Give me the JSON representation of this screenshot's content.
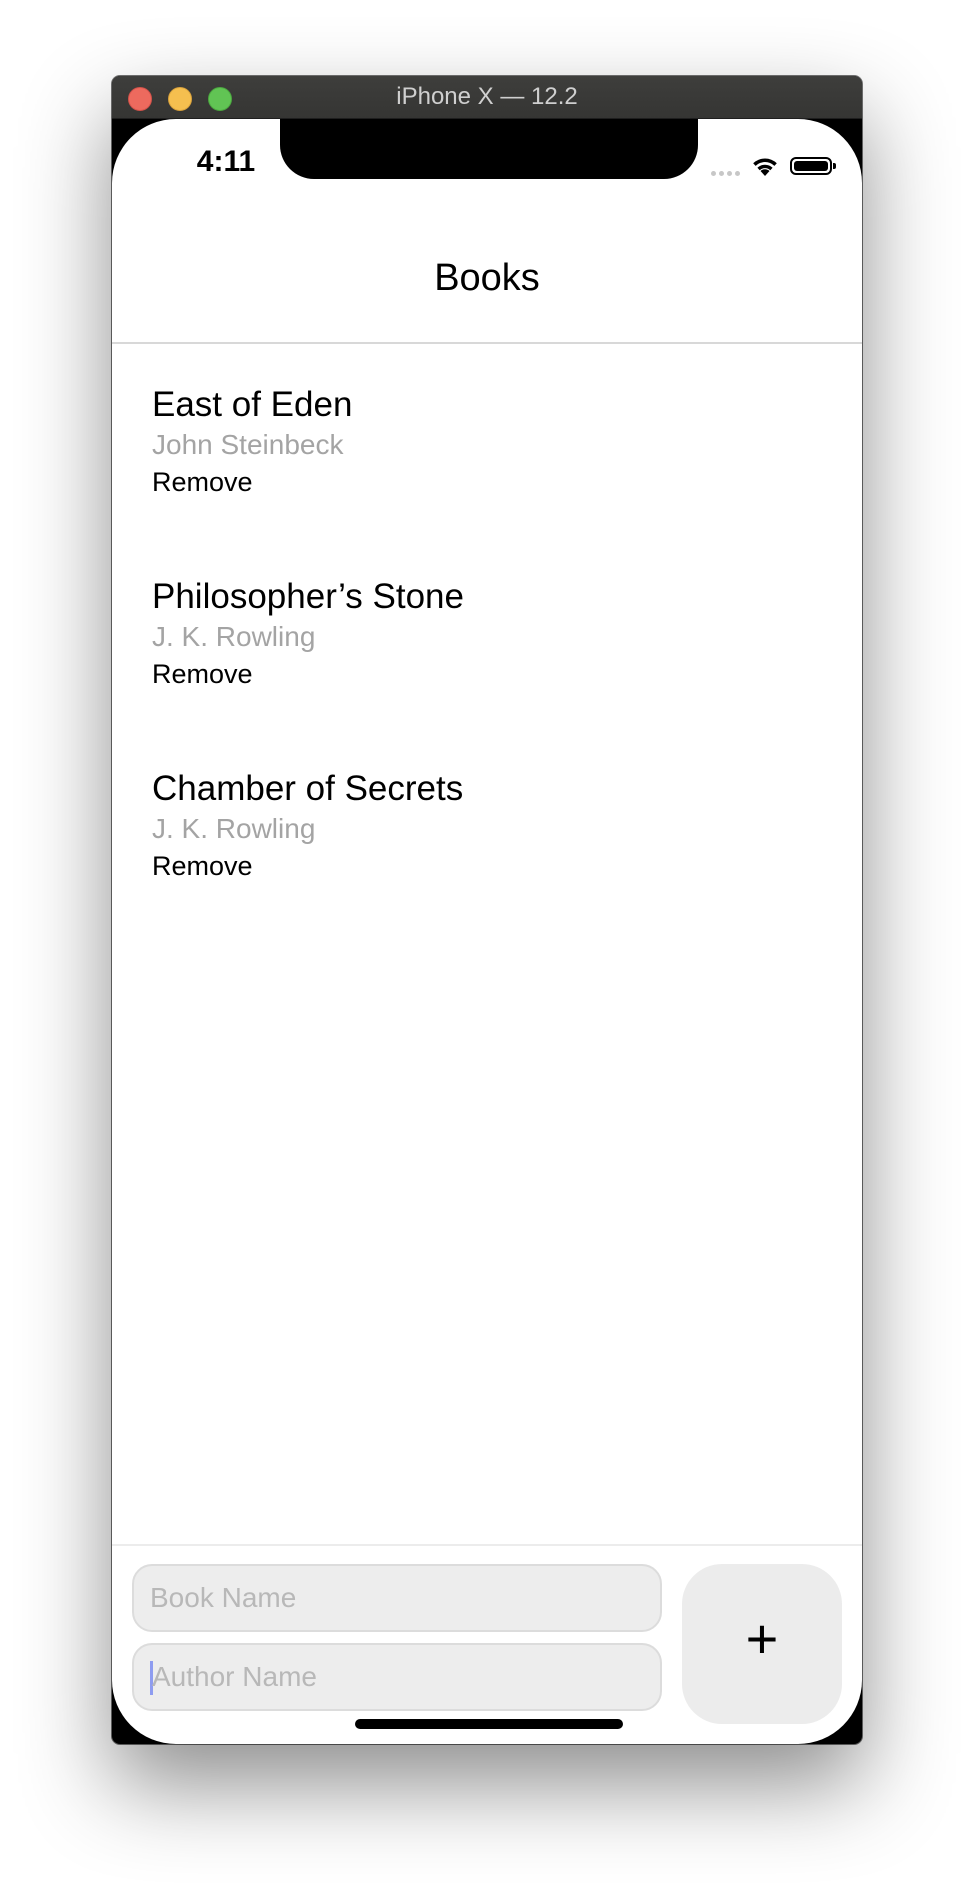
{
  "window": {
    "title": "iPhone X — 12.2"
  },
  "status_bar": {
    "time": "4:11",
    "icons": [
      "signal-dots-icon",
      "wifi-icon",
      "battery-icon"
    ]
  },
  "nav": {
    "title": "Books"
  },
  "books": [
    {
      "title": "East of Eden",
      "author": "John Steinbeck",
      "remove_label": "Remove"
    },
    {
      "title": "Philosopher’s Stone",
      "author": "J. K. Rowling",
      "remove_label": "Remove"
    },
    {
      "title": "Chamber of Secrets",
      "author": "J. K. Rowling",
      "remove_label": "Remove"
    }
  ],
  "form": {
    "book_placeholder": "Book Name",
    "author_placeholder": "Author Name",
    "add_label": "+"
  },
  "colors": {
    "close": "#ed6a5e",
    "minimize": "#f5bf4f",
    "maximize": "#61c454",
    "author_text": "#a4a4a4",
    "input_bg": "#ededed"
  }
}
